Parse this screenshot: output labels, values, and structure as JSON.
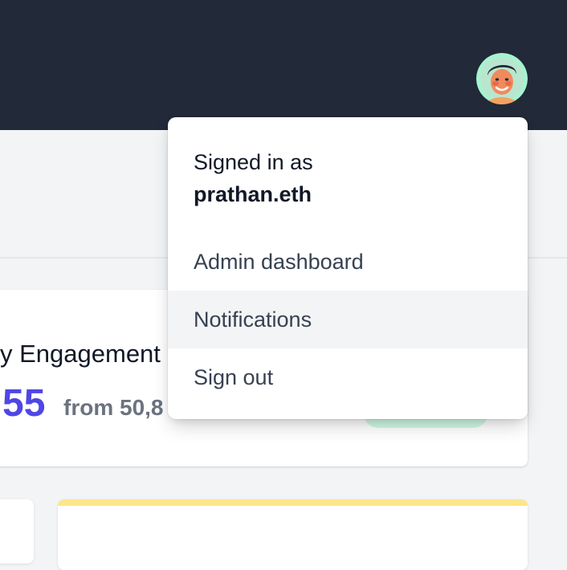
{
  "header": {
    "avatar_icon": "user-avatar-icon",
    "colors": {
      "background": "#222938",
      "avatar_ring": "#a7f3d0"
    }
  },
  "user_menu": {
    "signed_in_label": "Signed in as",
    "username": "prathan.eth",
    "items": [
      {
        "label": "Admin dashboard",
        "highlighted": false
      },
      {
        "label": "Notifications",
        "highlighted": true
      },
      {
        "label": "Sign out",
        "highlighted": false
      }
    ]
  },
  "stat_card": {
    "title": "y Engagement",
    "value": "55",
    "from_text": "from 50,8",
    "accent_color": "#4f46e5"
  }
}
